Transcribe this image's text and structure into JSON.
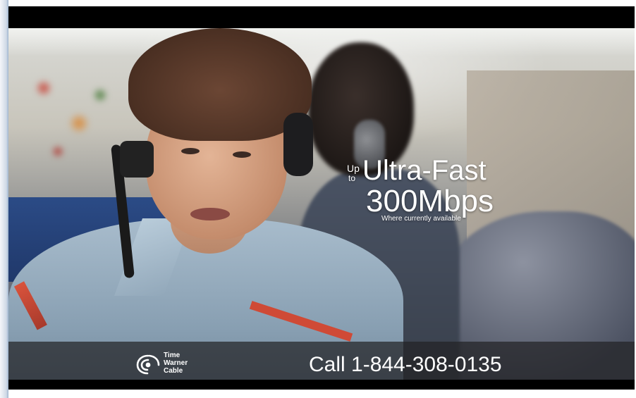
{
  "promo": {
    "up": "Up",
    "to": "to",
    "headline": "Ultra-Fast",
    "speed": "300Mbps",
    "note": "Where currently available"
  },
  "banner": {
    "logo_lines": [
      "Time",
      "Warner",
      "Cable"
    ],
    "call": "Call 1-844-308-0135"
  },
  "colors": {
    "overlay_text": "#ffffff",
    "banner_bg": "#232326"
  },
  "icons": {
    "logo": "time-warner-cable-logo-icon"
  }
}
